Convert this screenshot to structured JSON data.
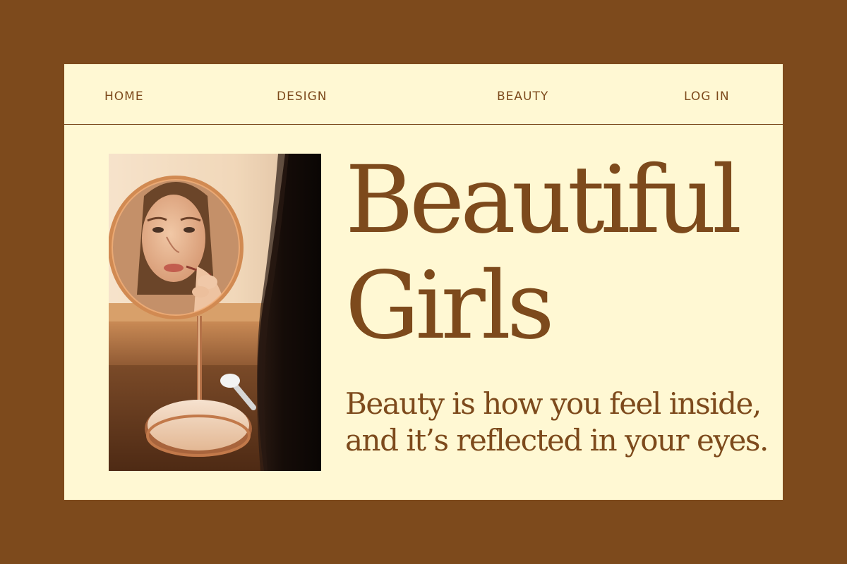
{
  "nav": {
    "home": "HOME",
    "design": "DESIGN",
    "beauty": "BEAUTY",
    "login": "LOG IN"
  },
  "hero": {
    "title_line1": "Beautiful",
    "title_line2": "Girls",
    "tagline_line1": "Beauty is how you feel inside,",
    "tagline_line2": "and it’s reflected in your eyes."
  },
  "photo": {
    "subject": "woman applying lipstick in a round mirror"
  },
  "colors": {
    "background": "#7d4a1c",
    "panel": "#fff8d3",
    "accent": "#7d4a1c"
  }
}
